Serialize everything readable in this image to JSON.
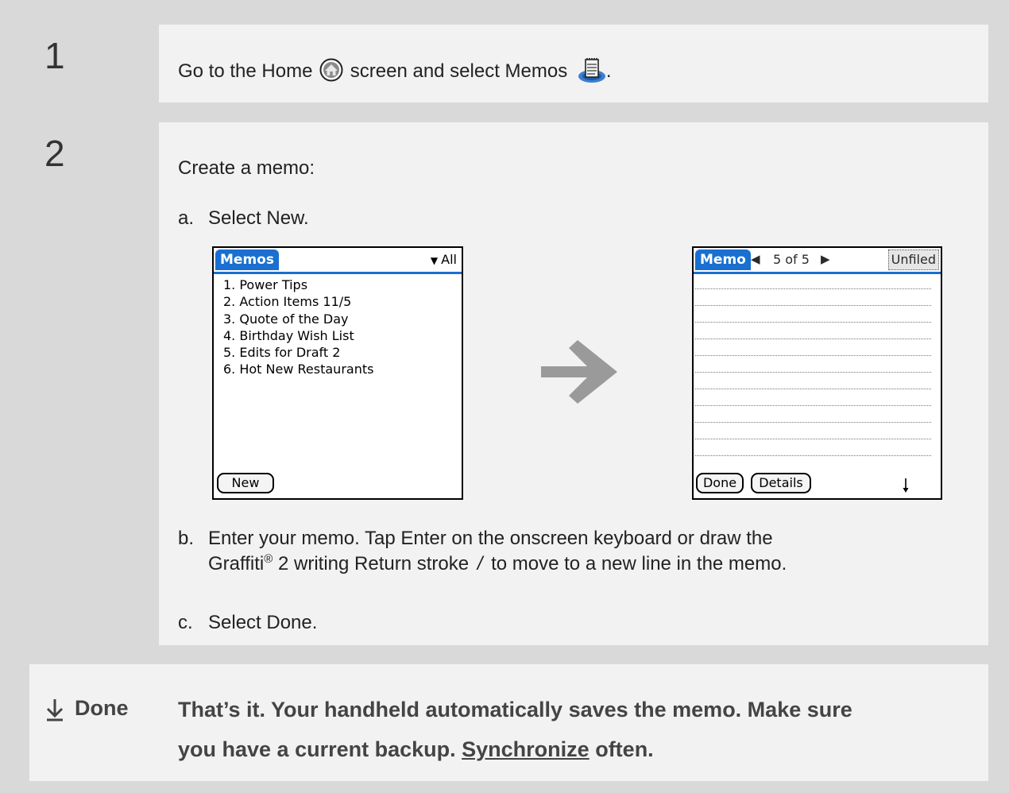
{
  "step1": {
    "number": "1",
    "text_before": "Go to the Home",
    "text_middle": "screen and select Memos",
    "text_after": "."
  },
  "step2": {
    "number": "2",
    "intro": "Create a memo:",
    "a": {
      "marker": "a.",
      "text": "Select New."
    },
    "b": {
      "marker": "b.",
      "line1": "Enter your memo. Tap Enter on the onscreen keyboard or draw the",
      "line2_before": "Graffiti",
      "registered": "®",
      "line2_mid": " 2 writing Return stroke",
      "stroke_glyph": "/",
      "line2_after": "to move to a new line in the memo."
    },
    "c": {
      "marker": "c.",
      "text": "Select Done."
    }
  },
  "memos_screen": {
    "title": "Memos",
    "category": "All",
    "items": [
      "1. Power Tips",
      "2. Action Items 11/5",
      "3. Quote of the Day",
      "4. Birthday Wish List",
      "5. Edits for Draft 2",
      "6. Hot New Restaurants"
    ],
    "new_button": "New"
  },
  "memo_screen": {
    "title": "Memo",
    "record": "5 of 5",
    "category": "Unfiled",
    "done_button": "Done",
    "details_button": "Details"
  },
  "footer": {
    "done_label": "Done",
    "text1": "That’s it. Your handheld automatically saves the memo. Make sure",
    "text2_before": "you have a current backup.",
    "link": "Synchronize",
    "text2_after": "often."
  },
  "colors": {
    "page_bg": "#d9d9d9",
    "panel_bg": "#f2f2f2",
    "palm_blue": "#1a6fd0",
    "arrow_gray": "#9a9a9a"
  },
  "icons": [
    "home-icon",
    "memos-icon",
    "right-arrow-icon",
    "down-arrow-icon",
    "graffiti-return-stroke-icon"
  ]
}
